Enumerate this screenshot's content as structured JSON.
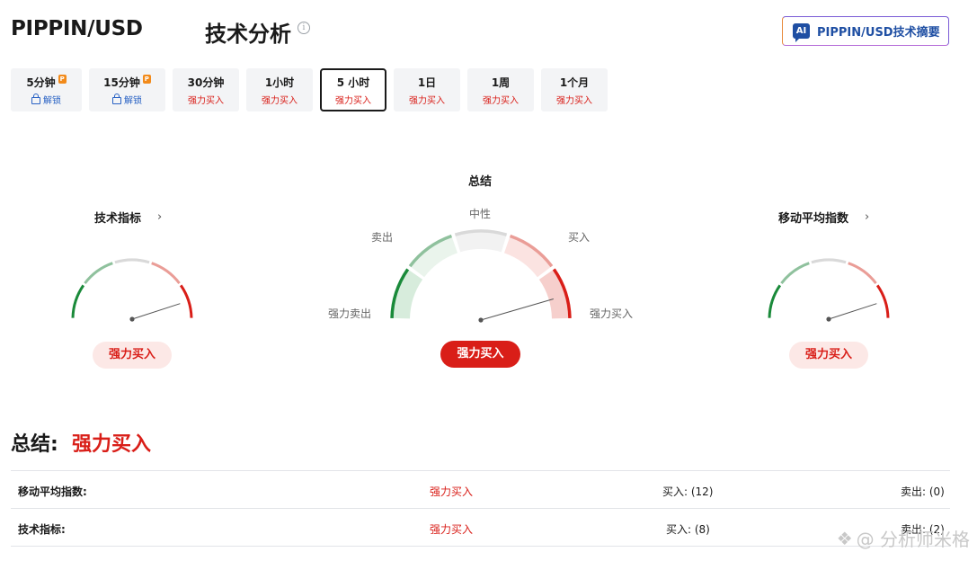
{
  "header": {
    "pair": "PIPPIN/USD",
    "title": "技术分析",
    "ai_button_badge": "AI",
    "ai_button_label": "PIPPIN/USD技术摘要"
  },
  "tabs": [
    {
      "label": "5分钟",
      "sub": "解锁",
      "locked": true,
      "active": false
    },
    {
      "label": "15分钟",
      "sub": "解锁",
      "locked": true,
      "active": false
    },
    {
      "label": "30分钟",
      "sub": "强力买入",
      "locked": false,
      "active": false
    },
    {
      "label": "1小时",
      "sub": "强力买入",
      "locked": false,
      "active": false
    },
    {
      "label": "5 小时",
      "sub": "强力买入",
      "locked": false,
      "active": true
    },
    {
      "label": "1日",
      "sub": "强力买入",
      "locked": false,
      "active": false
    },
    {
      "label": "1周",
      "sub": "强力买入",
      "locked": false,
      "active": false
    },
    {
      "label": "1个月",
      "sub": "强力买入",
      "locked": false,
      "active": false
    }
  ],
  "gauges": {
    "technical": {
      "title": "技术指标",
      "verdict": "强力买入",
      "needle_level": 0.9
    },
    "summary": {
      "title": "总结",
      "verdict": "强力买入",
      "needle_level": 0.91,
      "labels": {
        "neutral": "中性",
        "sell": "卖出",
        "buy": "买入",
        "strong_sell": "强力卖出",
        "strong_buy": "强力买入"
      }
    },
    "moving_averages": {
      "title": "移动平均指数",
      "verdict": "强力买入",
      "needle_level": 0.9
    }
  },
  "summary": {
    "title": "总结:",
    "value": "强力买入",
    "rows": [
      {
        "label": "移动平均指数:",
        "verdict": "强力买入",
        "buy": "买入: (12)",
        "sell": "卖出: (0)"
      },
      {
        "label": "技术指标:",
        "verdict": "强力买入",
        "buy": "买入: (8)",
        "sell": "卖出: (2)"
      }
    ]
  },
  "watermark": "@ 分析师米格",
  "colors": {
    "strong_sell": "#1a8a3a",
    "sell": "#8fc19d",
    "neutral": "#d9d9d9",
    "buy": "#ea9d97",
    "strong_buy": "#d91e18"
  }
}
